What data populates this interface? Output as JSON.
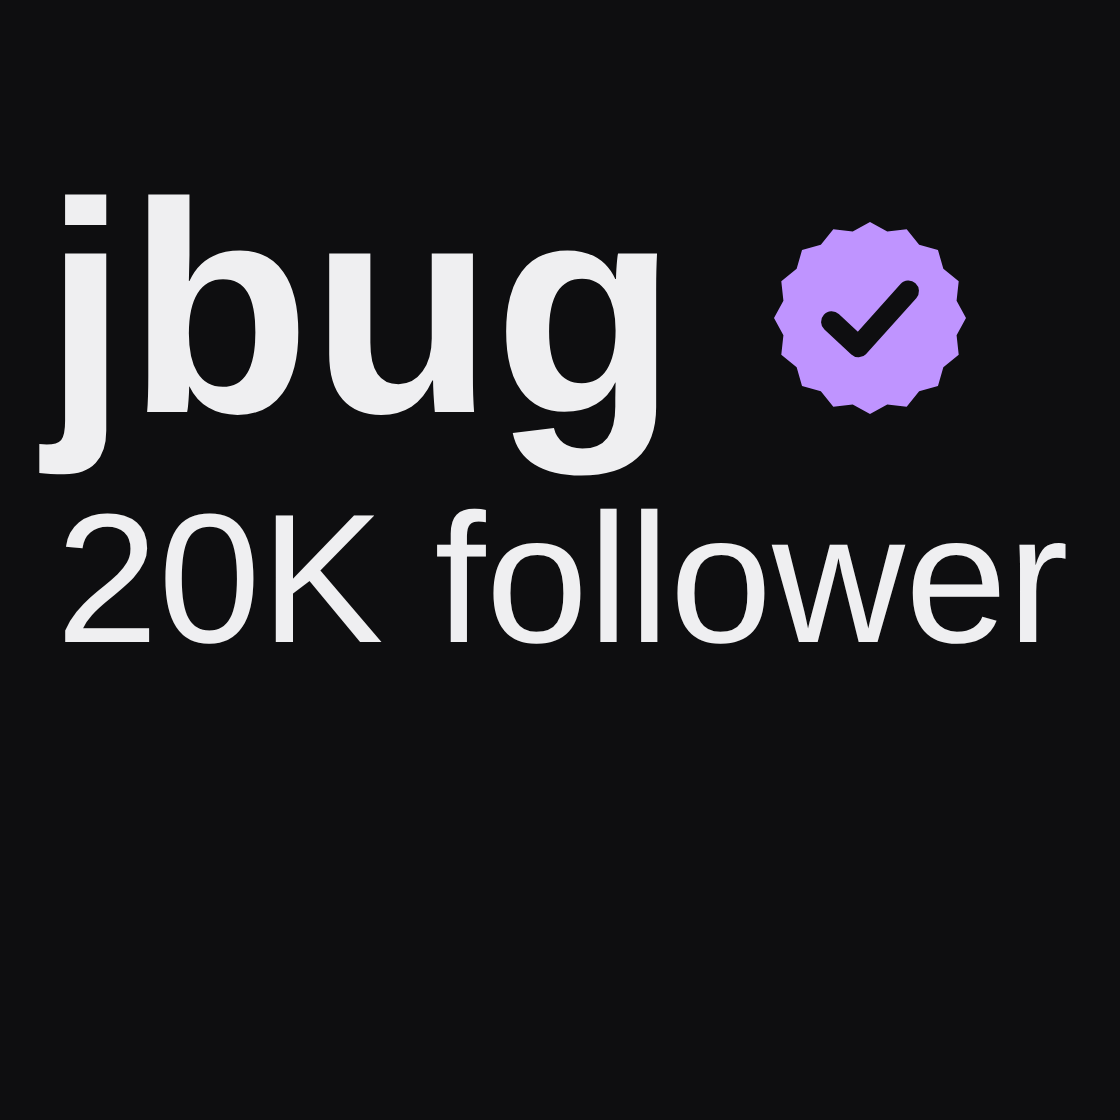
{
  "profile": {
    "name": "jbug",
    "verified": true,
    "followers": "20K follower"
  }
}
